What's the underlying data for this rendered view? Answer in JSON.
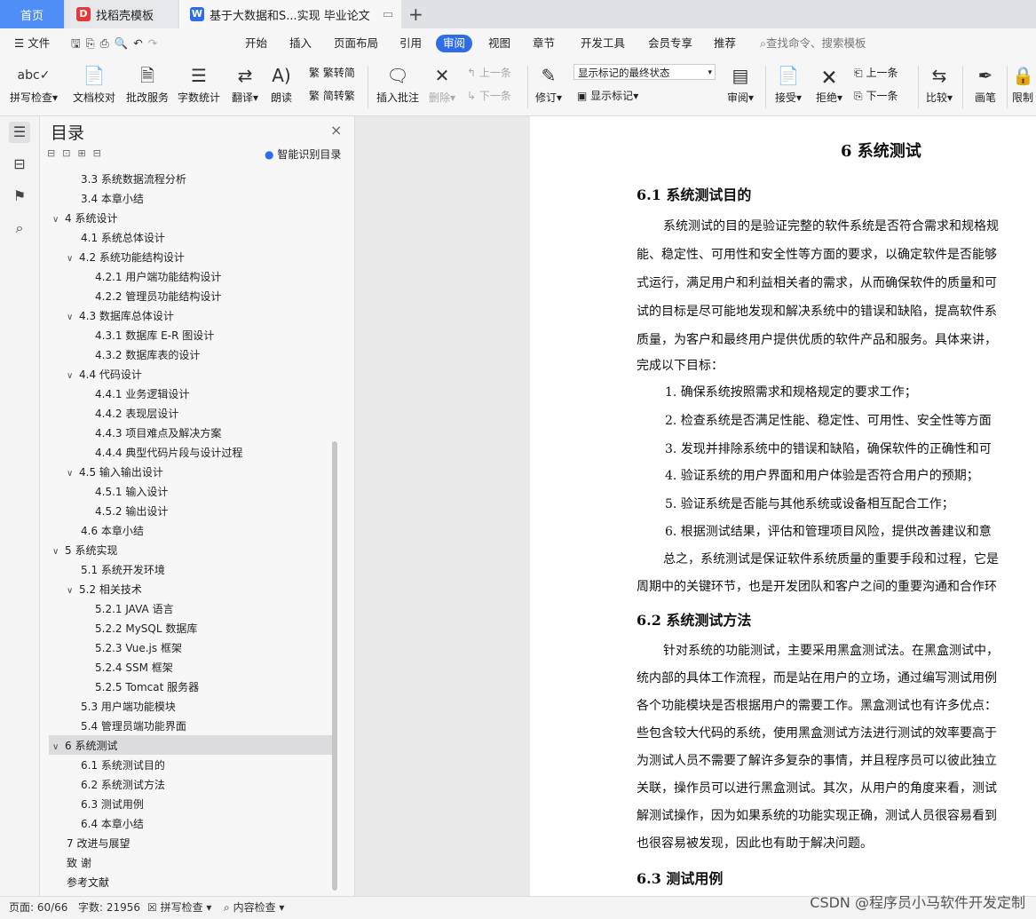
{
  "tabs": {
    "home": "首页",
    "template": "找稻壳模板",
    "doc": "基于大数据和S...实现 毕业论文"
  },
  "menu": {
    "file": "文件",
    "items": [
      "开始",
      "插入",
      "页面布局",
      "引用",
      "审阅",
      "视图",
      "章节",
      "开发工具",
      "会员专享",
      "推荐"
    ],
    "search_placeholder": "查找命令、搜索模板"
  },
  "ribbon": {
    "spell": "拼写检查",
    "proof": "文档校对",
    "batch": "批改服务",
    "wordcount": "字数统计",
    "translate": "翻译",
    "read": "朗读",
    "trad": "繁转简",
    "simp": "简转繁",
    "insert_comment": "插入批注",
    "delete": "删除",
    "prev_comment": "上一条",
    "next_comment": "下一条",
    "revise": "修订",
    "markup_select": "显示标记的最终状态",
    "show_markup": "显示标记",
    "review": "审阅",
    "accept": "接受",
    "reject": "拒绝",
    "prev": "上一条",
    "next": "下一条",
    "compare": "比较",
    "pen": "画笔",
    "limit": "限制"
  },
  "toc": {
    "title": "目录",
    "smart": "智能识别目录",
    "items": [
      "3.3 系统数据流程分析",
      "3.4 本章小结",
      "4  系统设计",
      "4.1 系统总体设计",
      "4.2 系统功能结构设计",
      "4.2.1 用户端功能结构设计",
      "4.2.2 管理员功能结构设计",
      "4.3 数据库总体设计",
      "4.3.1  数据库 E-R 图设计",
      "4.3.2  数据库表的设计",
      "4.4 代码设计",
      "4.4.1 业务逻辑设计",
      "4.4.2 表现层设计",
      "4.4.3 项目难点及解决方案",
      "4.4.4 典型代码片段与设计过程",
      "4.5 输入输出设计",
      "4.5.1 输入设计",
      "4.5.2 输出设计",
      "4.6 本章小结",
      "5  系统实现",
      "5.1 系统开发环境",
      "5.2 相关技术",
      "5.2.1 JAVA 语言",
      "5.2.2 MySQL 数据库",
      "5.2.3 Vue.js 框架",
      "5.2.4 SSM 框架",
      "5.2.5 Tomcat 服务器",
      "5.3 用户端功能模块",
      "5.4 管理员端功能界面",
      "6 系统测试",
      "6.1 系统测试目的",
      "6.2 系统测试方法",
      "6.3 测试用例",
      "6.4 本章小结",
      "7 改进与展望",
      "致    谢",
      "参考文献"
    ]
  },
  "document": {
    "title": "6 系统测试",
    "h61": "6.1 系统测试目的",
    "p1": [
      "系统测试的目的是验证完整的软件系统是否符合需求和规格规",
      "能、稳定性、可用性和安全性等方面的要求，以确定软件是否能够",
      "式运行，满足用户和利益相关者的需求，从而确保软件的质量和可",
      "试的目标是尽可能地发现和解决系统中的错误和缺陷，提高软件系",
      "质量，为客户和最终用户提供优质的软件产品和服务。具体来讲，",
      "完成以下目标："
    ],
    "list": [
      "1. 确保系统按照需求和规格规定的要求工作；",
      "2. 检查系统是否满足性能、稳定性、可用性、安全性等方面",
      "3. 发现并排除系统中的错误和缺陷，确保软件的正确性和可",
      "4. 验证系统的用户界面和用户体验是否符合用户的预期；",
      "5. 验证系统是否能与其他系统或设备相互配合工作；",
      "6. 根据测试结果，评估和管理项目风险，提供改善建议和意"
    ],
    "p2": [
      "总之，系统测试是保证软件系统质量的重要手段和过程，它是",
      "周期中的关键环节，也是开发团队和客户之间的重要沟通和合作环"
    ],
    "h62": "6.2 系统测试方法",
    "p3": [
      "针对系统的功能测试，主要采用黑盒测试法。在黑盒测试中，",
      "统内部的具体工作流程，而是站在用户的立场，通过编写测试用例",
      "各个功能模块是否根据用户的需要工作。黑盒测试也有许多优点：",
      "些包含较大代码的系统，使用黑盒测试方法进行测试的效率要高于",
      "为测试人员不需要了解许多复杂的事情，并且程序员可以彼此独立",
      "关联，操作员可以进行黑盒测试。其次，从用户的角度来看，测试",
      "解测试操作，因为如果系统的功能实现正确，测试人员很容易看到",
      "也很容易被发现，因此也有助于解决问题。"
    ],
    "h63": "6.3 测试用例"
  },
  "status": {
    "page": "页面: 60/66",
    "words": "字数: 21956",
    "spell": "拼写检查",
    "content": "内容检查",
    "watermark": "CSDN @程序员小马软件开发定制"
  }
}
